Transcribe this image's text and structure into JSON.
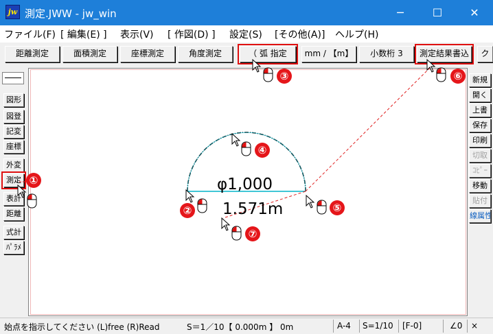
{
  "window": {
    "title": "測定.JWW - jw_win",
    "icon_text": "jw",
    "minimize": "─",
    "maximize": "☐",
    "close": "✕"
  },
  "menu": [
    "ファイル(F)",
    "[ 編集(E) ]",
    "表示(V)",
    "[ 作図(D) ]",
    "設定(S)",
    "[その他(A)]",
    "ヘルプ(H)"
  ],
  "toolbar": {
    "buttons": [
      "距離測定",
      "面積測定",
      "座標測定",
      "角度測定",
      "（ 弧  指定",
      "mm / 【m】",
      "小数桁 3",
      "測定結果書込",
      "ク"
    ]
  },
  "left_palette": [
    "図形",
    "図登",
    "記変",
    "座標",
    "外変",
    "測定",
    "表計",
    "距離",
    "式計",
    "ﾊﾟﾗﾒ"
  ],
  "right_palette": [
    "新規",
    "開く",
    "上書",
    "保存",
    "印刷",
    "切取",
    "ｺﾋﾟｰ",
    "移動",
    "貼付",
    "線属性"
  ],
  "drawing": {
    "diameter_label": "φ1,000",
    "arc_length_label": "1.571m"
  },
  "annotations": [
    "①",
    "②",
    "③",
    "④",
    "⑤",
    "⑥",
    "⑦"
  ],
  "status": {
    "prompt": "始点を指示してください (L)free (R)Read",
    "scale": "S＝1／10【 0.000m 】 0m",
    "paper": "A-4",
    "scale_short": "S=1/10",
    "layer": "[F-0]",
    "angle": "∠0",
    "zoom": "×"
  },
  "colors": {
    "titlebar": "#1e7fd9",
    "highlight": "#e01010",
    "badge": "#e5161a",
    "arc": "#000000",
    "chord": "#00b4c8",
    "guide": "#e02020"
  }
}
